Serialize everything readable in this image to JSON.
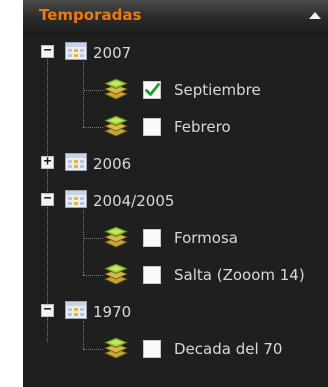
{
  "panel": {
    "title": "Temporadas",
    "collapse_icon": "triangle-up-icon"
  },
  "tree": [
    {
      "label": "2007",
      "expanded": true,
      "children": [
        {
          "label": "Septiembre",
          "checked": true
        },
        {
          "label": "Febrero",
          "checked": false
        }
      ]
    },
    {
      "label": "2006",
      "expanded": false,
      "children": []
    },
    {
      "label": "2004/2005",
      "expanded": true,
      "children": [
        {
          "label": "Formosa",
          "checked": false
        },
        {
          "label": "Salta (Zooom 14)",
          "checked": false
        }
      ]
    },
    {
      "label": "1970",
      "expanded": true,
      "children": [
        {
          "label": "Decada del 70",
          "checked": false
        }
      ]
    }
  ],
  "icons": {
    "folder": "calendar-folder-icon",
    "layer": "map-layer-icon",
    "expand": "plus-icon",
    "collapse": "minus-icon",
    "check": "checkmark-icon"
  },
  "colors": {
    "title": "#ec7a12",
    "panel_bg": "#1f1f1f",
    "label": "#d8d8d8",
    "check": "#1f9e2e"
  }
}
